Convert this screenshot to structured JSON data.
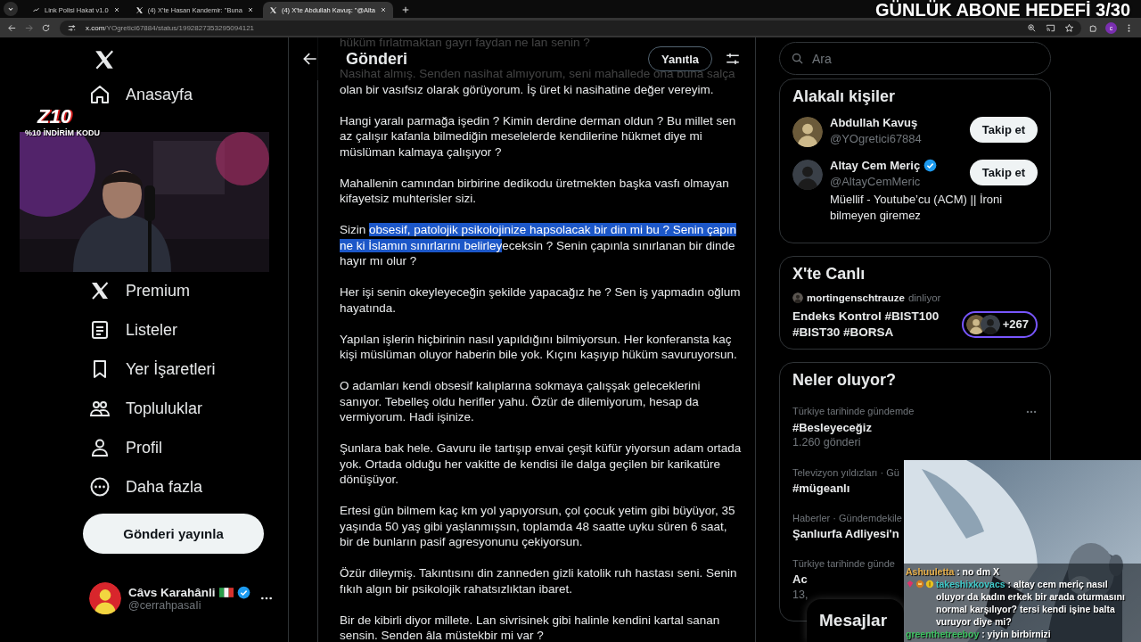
{
  "browser": {
    "tabs": [
      {
        "title": "Link Polisi Hakat v1.0",
        "selected": false
      },
      {
        "title": "(4) X'te Hasan Kandemir: \"Buna",
        "selected": false
      },
      {
        "title": "(4) X'te Abdullah Kavuş: \"@Alta",
        "selected": true
      }
    ],
    "url_host": "x.com",
    "url_path": "/YOgretici67884/status/1992827353295094121",
    "profile_initial": "c"
  },
  "stream_overlay": {
    "goal": "GÜNLÜK ABONE HEDEFİ 3/30",
    "logo": "Z10",
    "promo": "%10 İNDİRİM KODU",
    "chat": [
      {
        "user": "Ashuuletta",
        "color": "#e8b04a",
        "badges": false,
        "message": ": no dm X"
      },
      {
        "user": "takeshixkovacs",
        "color": "#3fc9c9",
        "badges": true,
        "message": ": altay cem meriç nasıl oluyor da kadın erkek bir arada oturmasını normal karşılıyor? tersi kendi işine balta vuruyor diye mi?"
      },
      {
        "user": "greenthetreeboy",
        "color": "#3cc060",
        "badges": false,
        "message": ": yiyin birbirnizi"
      }
    ]
  },
  "sidebar": {
    "items": [
      {
        "label": "Anasayfa"
      },
      {
        "label": "Premium"
      },
      {
        "label": "Listeler"
      },
      {
        "label": "Yer İşaretleri"
      },
      {
        "label": "Topluluklar"
      },
      {
        "label": "Profil"
      },
      {
        "label": "Daha fazla"
      }
    ],
    "post_button": "Gönderi yayınla",
    "account": {
      "name": "Câvs Karahânli",
      "verified": true,
      "handle": "@cerrahpasaIi"
    }
  },
  "post": {
    "title": "Gönderi",
    "reply_button": "Yanıtla",
    "paragraphs": [
      {
        "segments": [
          {
            "text": "hüküm fırlatmaktan gayrı faydan ne lan senin ?",
            "selected": false
          }
        ]
      },
      {
        "segments": [
          {
            "text": "Nasihat almış. Senden nasihat almıyorum, seni mahallede ona buna salça olan bir vasıfsız olarak görüyorum. İş üret ki nasihatine değer vereyim.",
            "selected": false
          }
        ]
      },
      {
        "segments": [
          {
            "text": "Hangi yaralı parmağa işedin ? Kimin derdine derman oldun ? Bu millet sen az çalışır kafanla bilmediğin meselelerde kendilerine hükmet diye mi müslüman kalmaya çalışıyor ?",
            "selected": false
          }
        ]
      },
      {
        "segments": [
          {
            "text": "Mahallenin camından birbirine dedikodu üretmekten başka vasfı olmayan kifayetsiz muhterisler sizi.",
            "selected": false
          }
        ]
      },
      {
        "segments": [
          {
            "text": "Sizin ",
            "selected": false
          },
          {
            "text": "obsesif, patolojik psikolojinize hapsolacak bir din mi bu ? Senin çapın ne ki İslamın sınırlarını belirley",
            "selected": true
          },
          {
            "text": "eceksin ? Senin çapınla sınırlanan bir dinde hayır mı olur ?",
            "selected": false
          }
        ]
      },
      {
        "segments": [
          {
            "text": "Her işi senin okeyleyeceğin şekilde yapacağız he ? Sen iş yapmadın oğlum hayatında.",
            "selected": false
          }
        ]
      },
      {
        "segments": [
          {
            "text": "Yapılan işlerin hiçbirinin nasıl yapıldığını bilmiyorsun. Her konferansta kaç kişi müslüman oluyor haberin bile yok. Kıçını kaşıyıp hüküm savuruyorsun.",
            "selected": false
          }
        ]
      },
      {
        "segments": [
          {
            "text": "O adamları kendi obsesif kalıplarına sokmaya çalışşak geleceklerini sanıyor. Tebelleş oldu herifler yahu. Özür de dilemiyorum, hesap da vermiyorum. Hadi işinize.",
            "selected": false
          }
        ]
      },
      {
        "segments": [
          {
            "text": "Şunlara bak hele. Gavuru ile tartışıp envai çeşit küfür yiyorsun adam ortada yok. Ortada olduğu her vakitte de kendisi ile dalga geçilen bir karikatüre dönüşüyor.",
            "selected": false
          }
        ]
      },
      {
        "segments": [
          {
            "text": "Ertesi gün bilmem kaç km yol yapıyorsun, çol çocuk yetim gibi büyüyor, 35 yaşında 50 yaş gibi yaşlanmışsın, toplamda 48 saatte uyku süren 6 saat, bir de bunların pasif agresyonunu çekiyorsun.",
            "selected": false
          }
        ]
      },
      {
        "segments": [
          {
            "text": "Özür dileymiş. Takıntısını din zanneden gizli katolik ruh hastası seni. Senin fıkıh algın bir psikolojik rahatsızlıktan ibaret.",
            "selected": false
          }
        ]
      },
      {
        "segments": [
          {
            "text": "Bir de kibirli diyor millete. Lan sivrisinek gibi halinle kendini kartal sanan sensin. Senden âla müstekbir mi var ?",
            "selected": false
          }
        ]
      }
    ]
  },
  "right": {
    "search_placeholder": "Ara",
    "related": {
      "title": "Alakalı kişiler",
      "people": [
        {
          "name": "Abdullah Kavuş",
          "verified": false,
          "handle": "@YOgretici67884",
          "button": "Takip et"
        },
        {
          "name": "Altay Cem Meriç",
          "verified": true,
          "handle": "@AltayCemMeric",
          "button": "Takip et",
          "bio": "Müellif - Youtube’cu (ACM) || İroni bilmeyen giremez"
        }
      ]
    },
    "live": {
      "title": "X'te Canlı",
      "host": "mortingenschtrauze",
      "host_status": "dinliyor",
      "space_title": "Endeks Kontrol #BIST100 #BIST30 #BORSA",
      "listeners": "+267"
    },
    "trends": {
      "title": "Neler oluyor?",
      "items": [
        {
          "category": "Türkiye tarihinde gündemde",
          "name": "#Besleyeceğiz",
          "count": "1.260 gönderi",
          "menu": true
        },
        {
          "category": "Televizyon yıldızları · Gü",
          "name": "#mügeanlı",
          "menu": false
        },
        {
          "category": "Haberler · Gündemdekile",
          "name": "Şanlıurfa Adliyesi'n",
          "menu": false
        },
        {
          "category": "Türkiye tarihinde günde",
          "name": "Ac",
          "count": "13,",
          "menu": false
        }
      ]
    },
    "messages": "Mesajlar"
  }
}
